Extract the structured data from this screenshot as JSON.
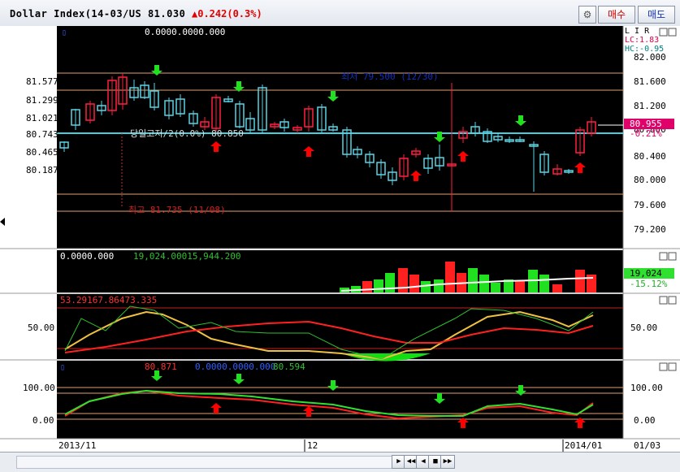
{
  "header": {
    "title": "Dollar Index(14-03/US 81.030",
    "change": "▲0.242(0.3%)",
    "sell_label": "매수",
    "buy_label": "매도",
    "settings_icon": "gear-icon"
  },
  "price_panel": {
    "corner_marker": "▯",
    "info_value": "0.0000.0000.000",
    "badge_lir": "L I R",
    "lc_text": "LC:1.83",
    "hc_text": "HC:-0.95",
    "right_ticks": [
      "82.000",
      "81.600",
      "81.200",
      "80.800",
      "80.400",
      "80.000",
      "79.600",
      "79.200"
    ],
    "left_levels": [
      "81.577",
      "81.299",
      "81.021",
      "80.743",
      "80.465",
      "80.187"
    ],
    "current_price": "80.955",
    "current_pct": "-0.21%",
    "median_label": "당일고저/2(0.0%) 80.850",
    "low_label": "최저 79.500 (12/30)",
    "high_label": "최고 81.735 (11/08)"
  },
  "volume_panel": {
    "values_text": "0.0000.000",
    "values_text2": "19,024.00015,944.200",
    "current_value": "19,024",
    "current_pct": "-15.12%"
  },
  "stoch_panel": {
    "values_text": "53.29167.86473.335",
    "left_tick": "50.00",
    "right_tick": "50.00"
  },
  "osc_panel": {
    "marker": "▯",
    "value_red": "80.871",
    "value_blue": "0.0000.0000.000",
    "value_green": "80.594",
    "left_ticks": [
      "100.00",
      "0.00"
    ],
    "right_ticks": [
      "100.00",
      "0.00"
    ]
  },
  "x_axis": {
    "labels": [
      "2013/11",
      "12",
      "2014/01"
    ],
    "right_label": "01/03"
  },
  "nav_buttons": [
    "▶",
    "◀◀",
    "◀",
    "■",
    "▶▶"
  ],
  "colors": {
    "background": "#000000",
    "up_candle": "#ff2040",
    "down_candle": "#5ad4e6",
    "arrow_up": "#ff0000",
    "arrow_down": "#20e020",
    "level_line": "#e0a070",
    "median_line": "#40d0e0"
  }
}
